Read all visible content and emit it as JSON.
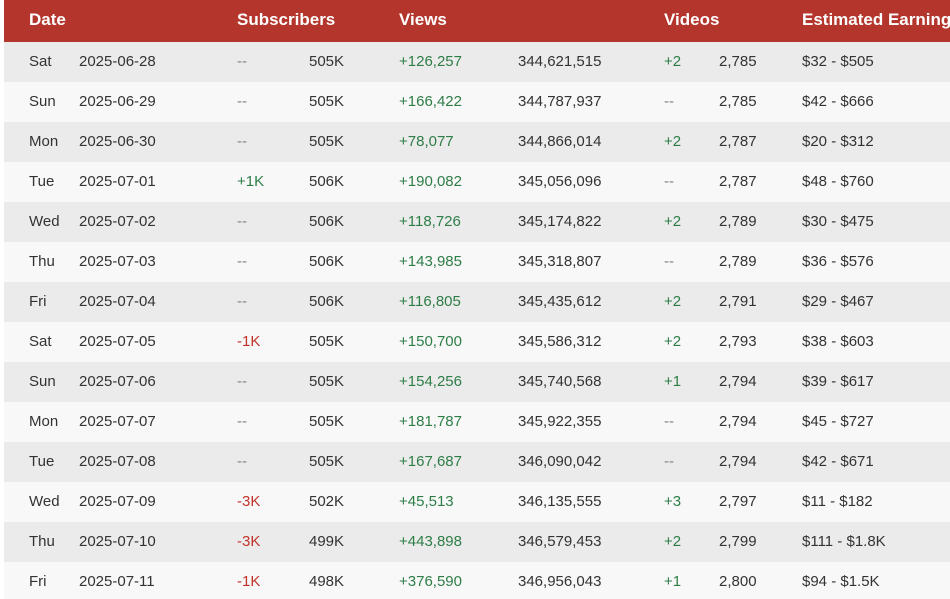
{
  "header": {
    "date": "Date",
    "subscribers": "Subscribers",
    "views": "Views",
    "videos": "Videos",
    "earnings": "Estimated Earnings"
  },
  "colors": {
    "header_bg": "#b3352c",
    "positive": "#2e7d47",
    "negative": "#c2332b",
    "neutral": "#808080"
  },
  "rows": [
    {
      "day": "Sat",
      "date": "2025-06-28",
      "sub_change": "--",
      "sub_total": "505K",
      "view_change": "+126,257",
      "view_total": "344,621,515",
      "video_change": "+2",
      "video_total": "2,785",
      "earnings": "$32 - $505"
    },
    {
      "day": "Sun",
      "date": "2025-06-29",
      "sub_change": "--",
      "sub_total": "505K",
      "view_change": "+166,422",
      "view_total": "344,787,937",
      "video_change": "--",
      "video_total": "2,785",
      "earnings": "$42 - $666"
    },
    {
      "day": "Mon",
      "date": "2025-06-30",
      "sub_change": "--",
      "sub_total": "505K",
      "view_change": "+78,077",
      "view_total": "344,866,014",
      "video_change": "+2",
      "video_total": "2,787",
      "earnings": "$20 - $312"
    },
    {
      "day": "Tue",
      "date": "2025-07-01",
      "sub_change": "+1K",
      "sub_total": "506K",
      "view_change": "+190,082",
      "view_total": "345,056,096",
      "video_change": "--",
      "video_total": "2,787",
      "earnings": "$48 - $760"
    },
    {
      "day": "Wed",
      "date": "2025-07-02",
      "sub_change": "--",
      "sub_total": "506K",
      "view_change": "+118,726",
      "view_total": "345,174,822",
      "video_change": "+2",
      "video_total": "2,789",
      "earnings": "$30 - $475"
    },
    {
      "day": "Thu",
      "date": "2025-07-03",
      "sub_change": "--",
      "sub_total": "506K",
      "view_change": "+143,985",
      "view_total": "345,318,807",
      "video_change": "--",
      "video_total": "2,789",
      "earnings": "$36 - $576"
    },
    {
      "day": "Fri",
      "date": "2025-07-04",
      "sub_change": "--",
      "sub_total": "506K",
      "view_change": "+116,805",
      "view_total": "345,435,612",
      "video_change": "+2",
      "video_total": "2,791",
      "earnings": "$29 - $467"
    },
    {
      "day": "Sat",
      "date": "2025-07-05",
      "sub_change": "-1K",
      "sub_total": "505K",
      "view_change": "+150,700",
      "view_total": "345,586,312",
      "video_change": "+2",
      "video_total": "2,793",
      "earnings": "$38 - $603"
    },
    {
      "day": "Sun",
      "date": "2025-07-06",
      "sub_change": "--",
      "sub_total": "505K",
      "view_change": "+154,256",
      "view_total": "345,740,568",
      "video_change": "+1",
      "video_total": "2,794",
      "earnings": "$39 - $617"
    },
    {
      "day": "Mon",
      "date": "2025-07-07",
      "sub_change": "--",
      "sub_total": "505K",
      "view_change": "+181,787",
      "view_total": "345,922,355",
      "video_change": "--",
      "video_total": "2,794",
      "earnings": "$45 - $727"
    },
    {
      "day": "Tue",
      "date": "2025-07-08",
      "sub_change": "--",
      "sub_total": "505K",
      "view_change": "+167,687",
      "view_total": "346,090,042",
      "video_change": "--",
      "video_total": "2,794",
      "earnings": "$42 - $671"
    },
    {
      "day": "Wed",
      "date": "2025-07-09",
      "sub_change": "-3K",
      "sub_total": "502K",
      "view_change": "+45,513",
      "view_total": "346,135,555",
      "video_change": "+3",
      "video_total": "2,797",
      "earnings": "$11 - $182"
    },
    {
      "day": "Thu",
      "date": "2025-07-10",
      "sub_change": "-3K",
      "sub_total": "499K",
      "view_change": "+443,898",
      "view_total": "346,579,453",
      "video_change": "+2",
      "video_total": "2,799",
      "earnings": "$111 - $1.8K"
    },
    {
      "day": "Fri",
      "date": "2025-07-11",
      "sub_change": "-1K",
      "sub_total": "498K",
      "view_change": "+376,590",
      "view_total": "346,956,043",
      "video_change": "+1",
      "video_total": "2,800",
      "earnings": "$94 - $1.5K"
    }
  ]
}
